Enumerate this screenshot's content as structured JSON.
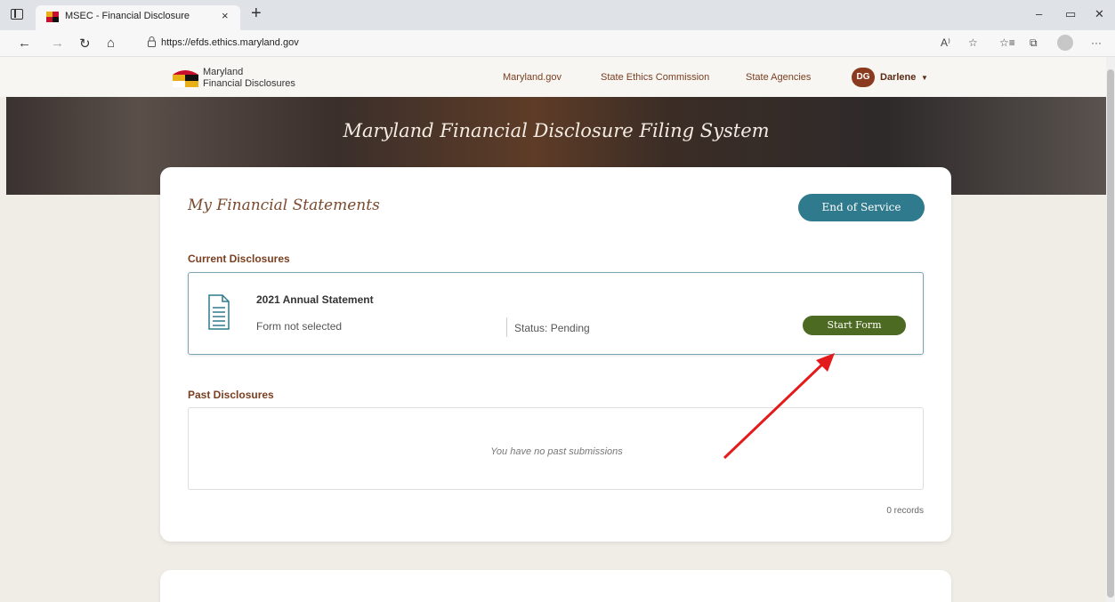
{
  "browser": {
    "tab_title": "MSEC - Financial Disclosure",
    "tab_close": "×",
    "new_tab": "+",
    "url": "https://efds.ethics.maryland.gov",
    "window_controls": {
      "minimize": "–",
      "restore": "▭",
      "close": "✕"
    },
    "icons": [
      "sidebar-icon",
      "back-icon",
      "forward-icon",
      "refresh-icon",
      "home-icon",
      "lock-icon",
      "read-aloud-icon",
      "favorite-icon",
      "favorites-list-icon",
      "collections-icon",
      "profile-icon",
      "more-icon"
    ]
  },
  "header": {
    "logo_line1": "Maryland",
    "logo_line2": "Financial Disclosures",
    "nav": [
      "Maryland.gov",
      "State Ethics Commission",
      "State Agencies"
    ],
    "user_initials": "DG",
    "user_name": "Darlene"
  },
  "hero": {
    "title": "Maryland Financial Disclosure Filing System"
  },
  "main": {
    "title": "My Financial Statements",
    "end_button": "End of Service",
    "current_label": "Current Disclosures",
    "current_item": {
      "title": "2021 Annual Statement",
      "form": "Form not selected",
      "status": "Status: Pending",
      "button": "Start Form"
    },
    "past_label": "Past Disclosures",
    "past_empty": "You have no past submissions",
    "records": "0 records"
  },
  "colors": {
    "accent_brown": "#7a3e20",
    "button_teal": "#2f7a8c",
    "button_green": "#4d6a22",
    "annotation_arrow": "#e31b1b"
  }
}
